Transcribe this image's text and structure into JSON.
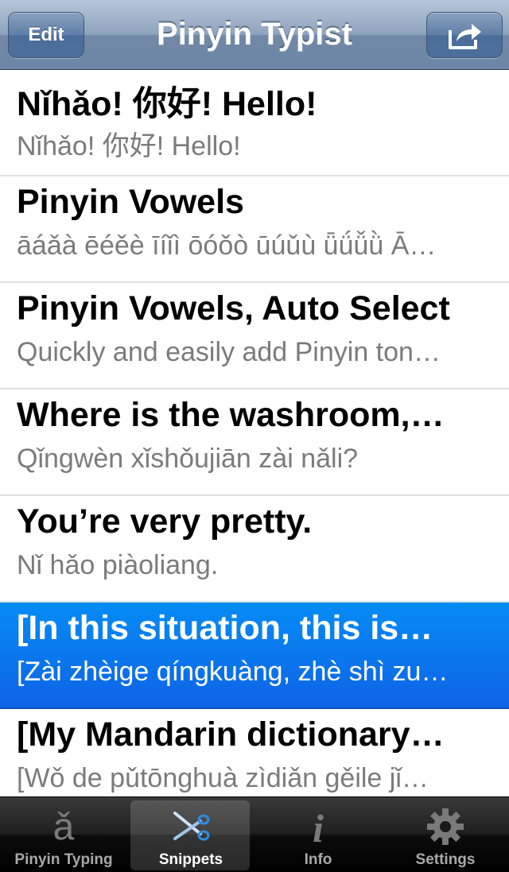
{
  "nav": {
    "title": "Pinyin Typist",
    "edit_label": "Edit"
  },
  "snippets": [
    {
      "title": "Nǐhǎo! 你好! Hello!",
      "subtitle": "Nǐhǎo! 你好! Hello!",
      "selected": false
    },
    {
      "title": "Pinyin Vowels",
      "subtitle": "āáǎà ēéěè īíǐì ōóǒò ūúǔù ǖǘǚǜ Ā…",
      "selected": false
    },
    {
      "title": "Pinyin Vowels, Auto Select",
      "subtitle": "Quickly and easily add Pinyin ton…",
      "selected": false
    },
    {
      "title": "Where is the washroom,…",
      "subtitle": "Qǐngwèn xǐshǒujiān zài nǎli?",
      "selected": false
    },
    {
      "title": "You’re very pretty.",
      "subtitle": "Nǐ hǎo piàoliang.",
      "selected": false
    },
    {
      "title": "[In this situation, this is…",
      "subtitle": "[Zài zhèige qíngkuàng, zhè shì zu…",
      "selected": true
    },
    {
      "title": "[My Mandarin dictionary…",
      "subtitle": "[Wǒ de pǔtōnghuà zìdiǎn gěile jǐ…",
      "selected": false
    }
  ],
  "tabs": [
    {
      "label": "Pinyin Typing",
      "glyph": "ǎ",
      "icon": "pinyin-a-icon"
    },
    {
      "label": "Snippets",
      "icon": "scissors-icon",
      "active": true
    },
    {
      "label": "Info",
      "glyph": "i",
      "icon": "info-icon"
    },
    {
      "label": "Settings",
      "icon": "gear-icon"
    }
  ],
  "colors": {
    "selected_row": "#0f63e6",
    "nav_bar": "#7189a7",
    "tab_bar": "#1f1f1f"
  }
}
